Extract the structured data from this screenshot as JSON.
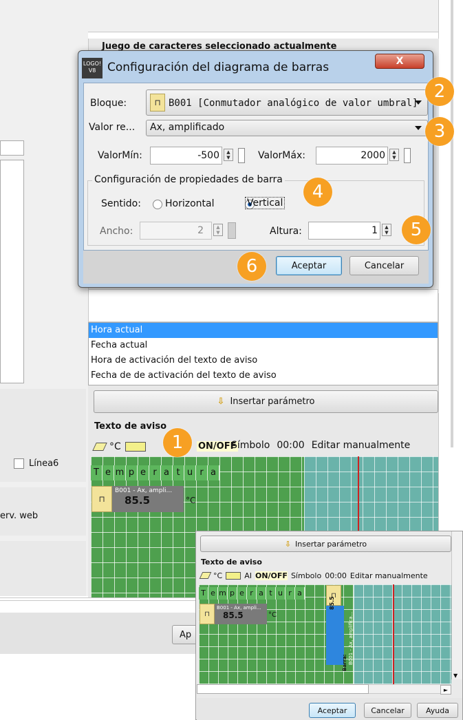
{
  "background": {
    "charset_label": "Juego de caracteres seleccionado actualmente",
    "linea6_label": "Línea6",
    "serv_web_label": "erv. web",
    "ap_button": "Ap",
    "parameter_list": [
      "Hora actual",
      "Fecha actual",
      "Hora de activación del texto de aviso",
      "Fecha de de activación del texto de aviso"
    ],
    "insert_param": "Insertar parámetro",
    "message_text": {
      "title": "Texto de aviso",
      "toolbar": [
        "°C",
        "ON/OFF",
        "Símbolo",
        "00:00",
        "Editar manualmente"
      ],
      "text_chars": [
        "T",
        "e",
        "m",
        "p",
        "e",
        "r",
        "a",
        "t",
        "u",
        "r",
        "a"
      ],
      "block_label": "B001 - Ax, ampli...",
      "block_value": "85.5",
      "unit": "°C"
    }
  },
  "dialog": {
    "icon_text": "LOGO! V8",
    "title": "Configuración del diagrama de barras",
    "close_label": "X",
    "bloque_label": "Bloque:",
    "bloque_value": "B001 [Conmutador analógico de valor umbral]",
    "valor_label": "Valor re...",
    "valor_value": "Ax, amplificado",
    "valormin_label": "ValorMín:",
    "valormin_value": "-500",
    "valormax_label": "ValorMáx:",
    "valormax_value": "2000",
    "group_title": "Configuración de propiedades de barra",
    "sentido_label": "Sentido:",
    "horizontal_label": "Horizontal",
    "vertical_label": "Vertical",
    "ancho_label": "Ancho:",
    "ancho_value": "2",
    "altura_label": "Altura:",
    "altura_value": "1",
    "accept": "Aceptar",
    "cancel": "Cancelar",
    "selected_orientation": "vertical"
  },
  "badges": [
    "1",
    "2",
    "3",
    "4",
    "5",
    "6"
  ],
  "inset": {
    "insert_param": "Insertar parámetro",
    "title": "Texto de aviso",
    "toolbar": [
      "°C",
      "AI",
      "ON/OFF",
      "Símbolo",
      "00:00",
      "Editar manualmente"
    ],
    "text_chars": [
      "T",
      "e",
      "m",
      "p",
      "e",
      "r",
      "a",
      "t",
      "u",
      "r",
      "a"
    ],
    "block_label": "B001 - Ax, ampli...",
    "block_value": "85.5",
    "unit": "°C",
    "bar_text_1": "B001 - Ax, amplifica...",
    "bar_text_2": "Barra:",
    "bar_text_3": "85.5",
    "accept": "Aceptar",
    "cancel": "Cancelar",
    "help": "Ayuda"
  },
  "colors": {
    "badge": "#f7a023",
    "selection": "#3399ff",
    "grid_green": "#4ea04e",
    "grid_teal": "#6ab3aa",
    "bar_blue": "#2e86de",
    "marker_red": "#cc2222"
  }
}
